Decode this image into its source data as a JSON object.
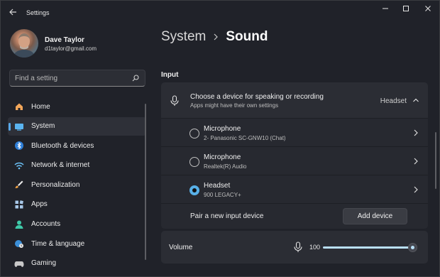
{
  "window": {
    "app_title": "Settings",
    "controls": [
      "minimize-icon",
      "maximize-icon",
      "close-icon"
    ]
  },
  "profile": {
    "name": "Dave Taylor",
    "email": "d1taylor@gmail.com"
  },
  "search": {
    "placeholder": "Find a setting",
    "icon": "search-icon"
  },
  "nav": {
    "items": [
      {
        "label": "Home",
        "icon": "home-icon",
        "color": "#f2a65a",
        "active": false
      },
      {
        "label": "System",
        "icon": "system-icon",
        "color": "#5ab4f0",
        "active": true
      },
      {
        "label": "Bluetooth & devices",
        "icon": "bluetooth-icon",
        "color": "#4aa3f0",
        "active": false
      },
      {
        "label": "Network & internet",
        "icon": "wifi-icon",
        "color": "#6bc0f5",
        "active": false
      },
      {
        "label": "Personalization",
        "icon": "brush-icon",
        "color": "#f0a040",
        "active": false
      },
      {
        "label": "Apps",
        "icon": "apps-icon",
        "color": "#a8c8e8",
        "active": false
      },
      {
        "label": "Accounts",
        "icon": "person-icon",
        "color": "#3ec9a8",
        "active": false
      },
      {
        "label": "Time & language",
        "icon": "globe-clock-icon",
        "color": "#5ab4f0",
        "active": false
      },
      {
        "label": "Gaming",
        "icon": "gaming-icon",
        "color": "#c8c8c8",
        "active": false
      }
    ]
  },
  "header": {
    "breadcrumb_parent": "System",
    "breadcrumb_current": "Sound"
  },
  "input_section": {
    "label": "Input",
    "device_header": {
      "title": "Choose a device for speaking or recording",
      "subtitle": "Apps might have their own settings",
      "value": "Headset"
    },
    "devices": [
      {
        "name": "Microphone",
        "detail": "2- Panasonic SC-GNW10 (Chat)",
        "selected": false
      },
      {
        "name": "Microphone",
        "detail": "Realtek(R) Audio",
        "selected": false
      },
      {
        "name": "Headset",
        "detail": "900 LEGACY+",
        "selected": true
      }
    ],
    "pair": {
      "label": "Pair a new input device",
      "button": "Add device"
    }
  },
  "volume": {
    "label": "Volume",
    "value": "100",
    "level": 1.0
  },
  "colors": {
    "accent": "#58b0e8",
    "background": "#202229",
    "card": "#2b2d34"
  }
}
